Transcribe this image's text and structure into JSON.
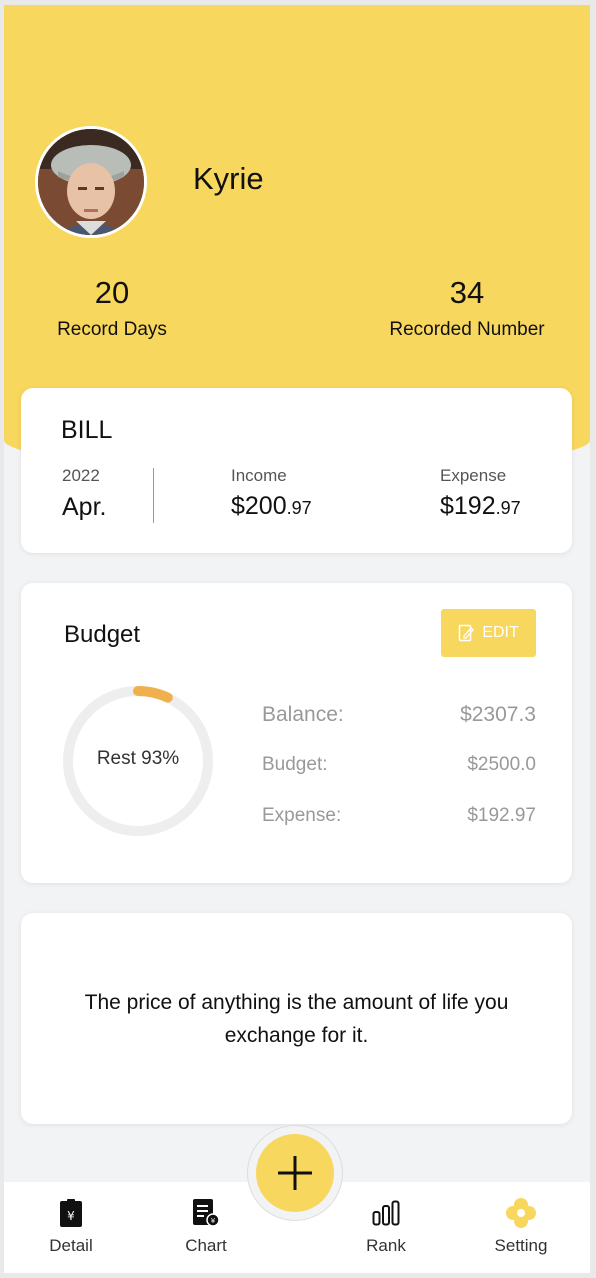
{
  "profile": {
    "name": "Kyrie"
  },
  "stats": [
    {
      "value": "20",
      "label": "Record Days"
    },
    {
      "value": "34",
      "label": "Recorded Number"
    }
  ],
  "bill": {
    "title": "BILL",
    "year": "2022",
    "month": "Apr.",
    "income_label": "Income",
    "income_main": "$200",
    "income_cents": ".97",
    "expense_label": "Expense",
    "expense_main": "$192",
    "expense_cents": ".97"
  },
  "budget": {
    "title": "Budget",
    "edit_label": "EDIT",
    "rest_text": "Rest 93%",
    "rest_percent": 93,
    "rows": [
      {
        "label": "Balance:",
        "value": "$2307.3"
      },
      {
        "label": "Budget:",
        "value": "$2500.0"
      },
      {
        "label": "Expense:",
        "value": "$192.97"
      }
    ]
  },
  "quote": {
    "text": "The price of anything is the amount of life you exchange for it."
  },
  "tabs": [
    {
      "label": "Detail",
      "icon": "receipt-icon"
    },
    {
      "label": "Chart",
      "icon": "report-icon"
    },
    {
      "label": "Rank",
      "icon": "bar-chart-icon"
    },
    {
      "label": "Setting",
      "icon": "flower-icon"
    }
  ],
  "fab": {
    "icon": "plus-icon"
  },
  "colors": {
    "accent": "#f8d75e",
    "ring_progress": "#f0b04e",
    "ring_track": "#eeeeee"
  }
}
